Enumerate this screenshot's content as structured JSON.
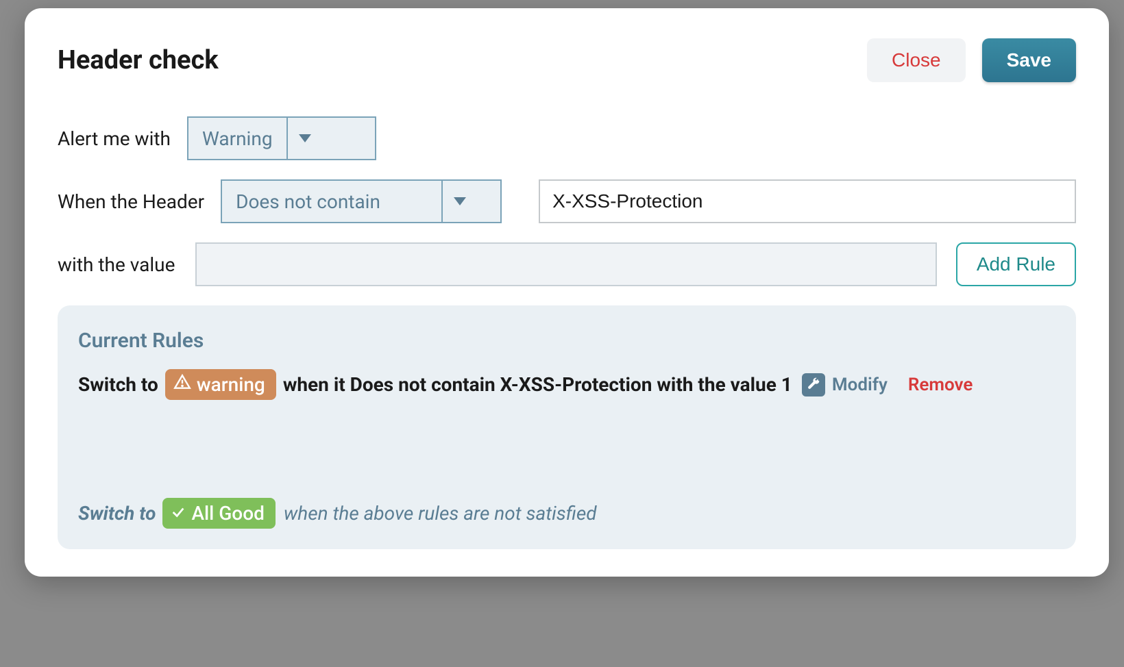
{
  "modal": {
    "title": "Header check",
    "close_label": "Close",
    "save_label": "Save"
  },
  "form": {
    "alert_label": "Alert me with",
    "alert_value": "Warning",
    "header_label": "When the Header",
    "header_condition": "Does not contain",
    "header_value": "X-XSS-Protection",
    "value_label": "with the value",
    "value_input": "",
    "add_rule_label": "Add Rule"
  },
  "rules": {
    "title": "Current Rules",
    "items": [
      {
        "prefix": "Switch to",
        "badge": "warning",
        "suffix": "when it Does not contain X-XSS-Protection with the value 1",
        "modify_label": "Modify",
        "remove_label": "Remove"
      }
    ],
    "footer": {
      "prefix": "Switch to",
      "badge": "All Good",
      "suffix": "when the above rules are not satisfied"
    }
  }
}
